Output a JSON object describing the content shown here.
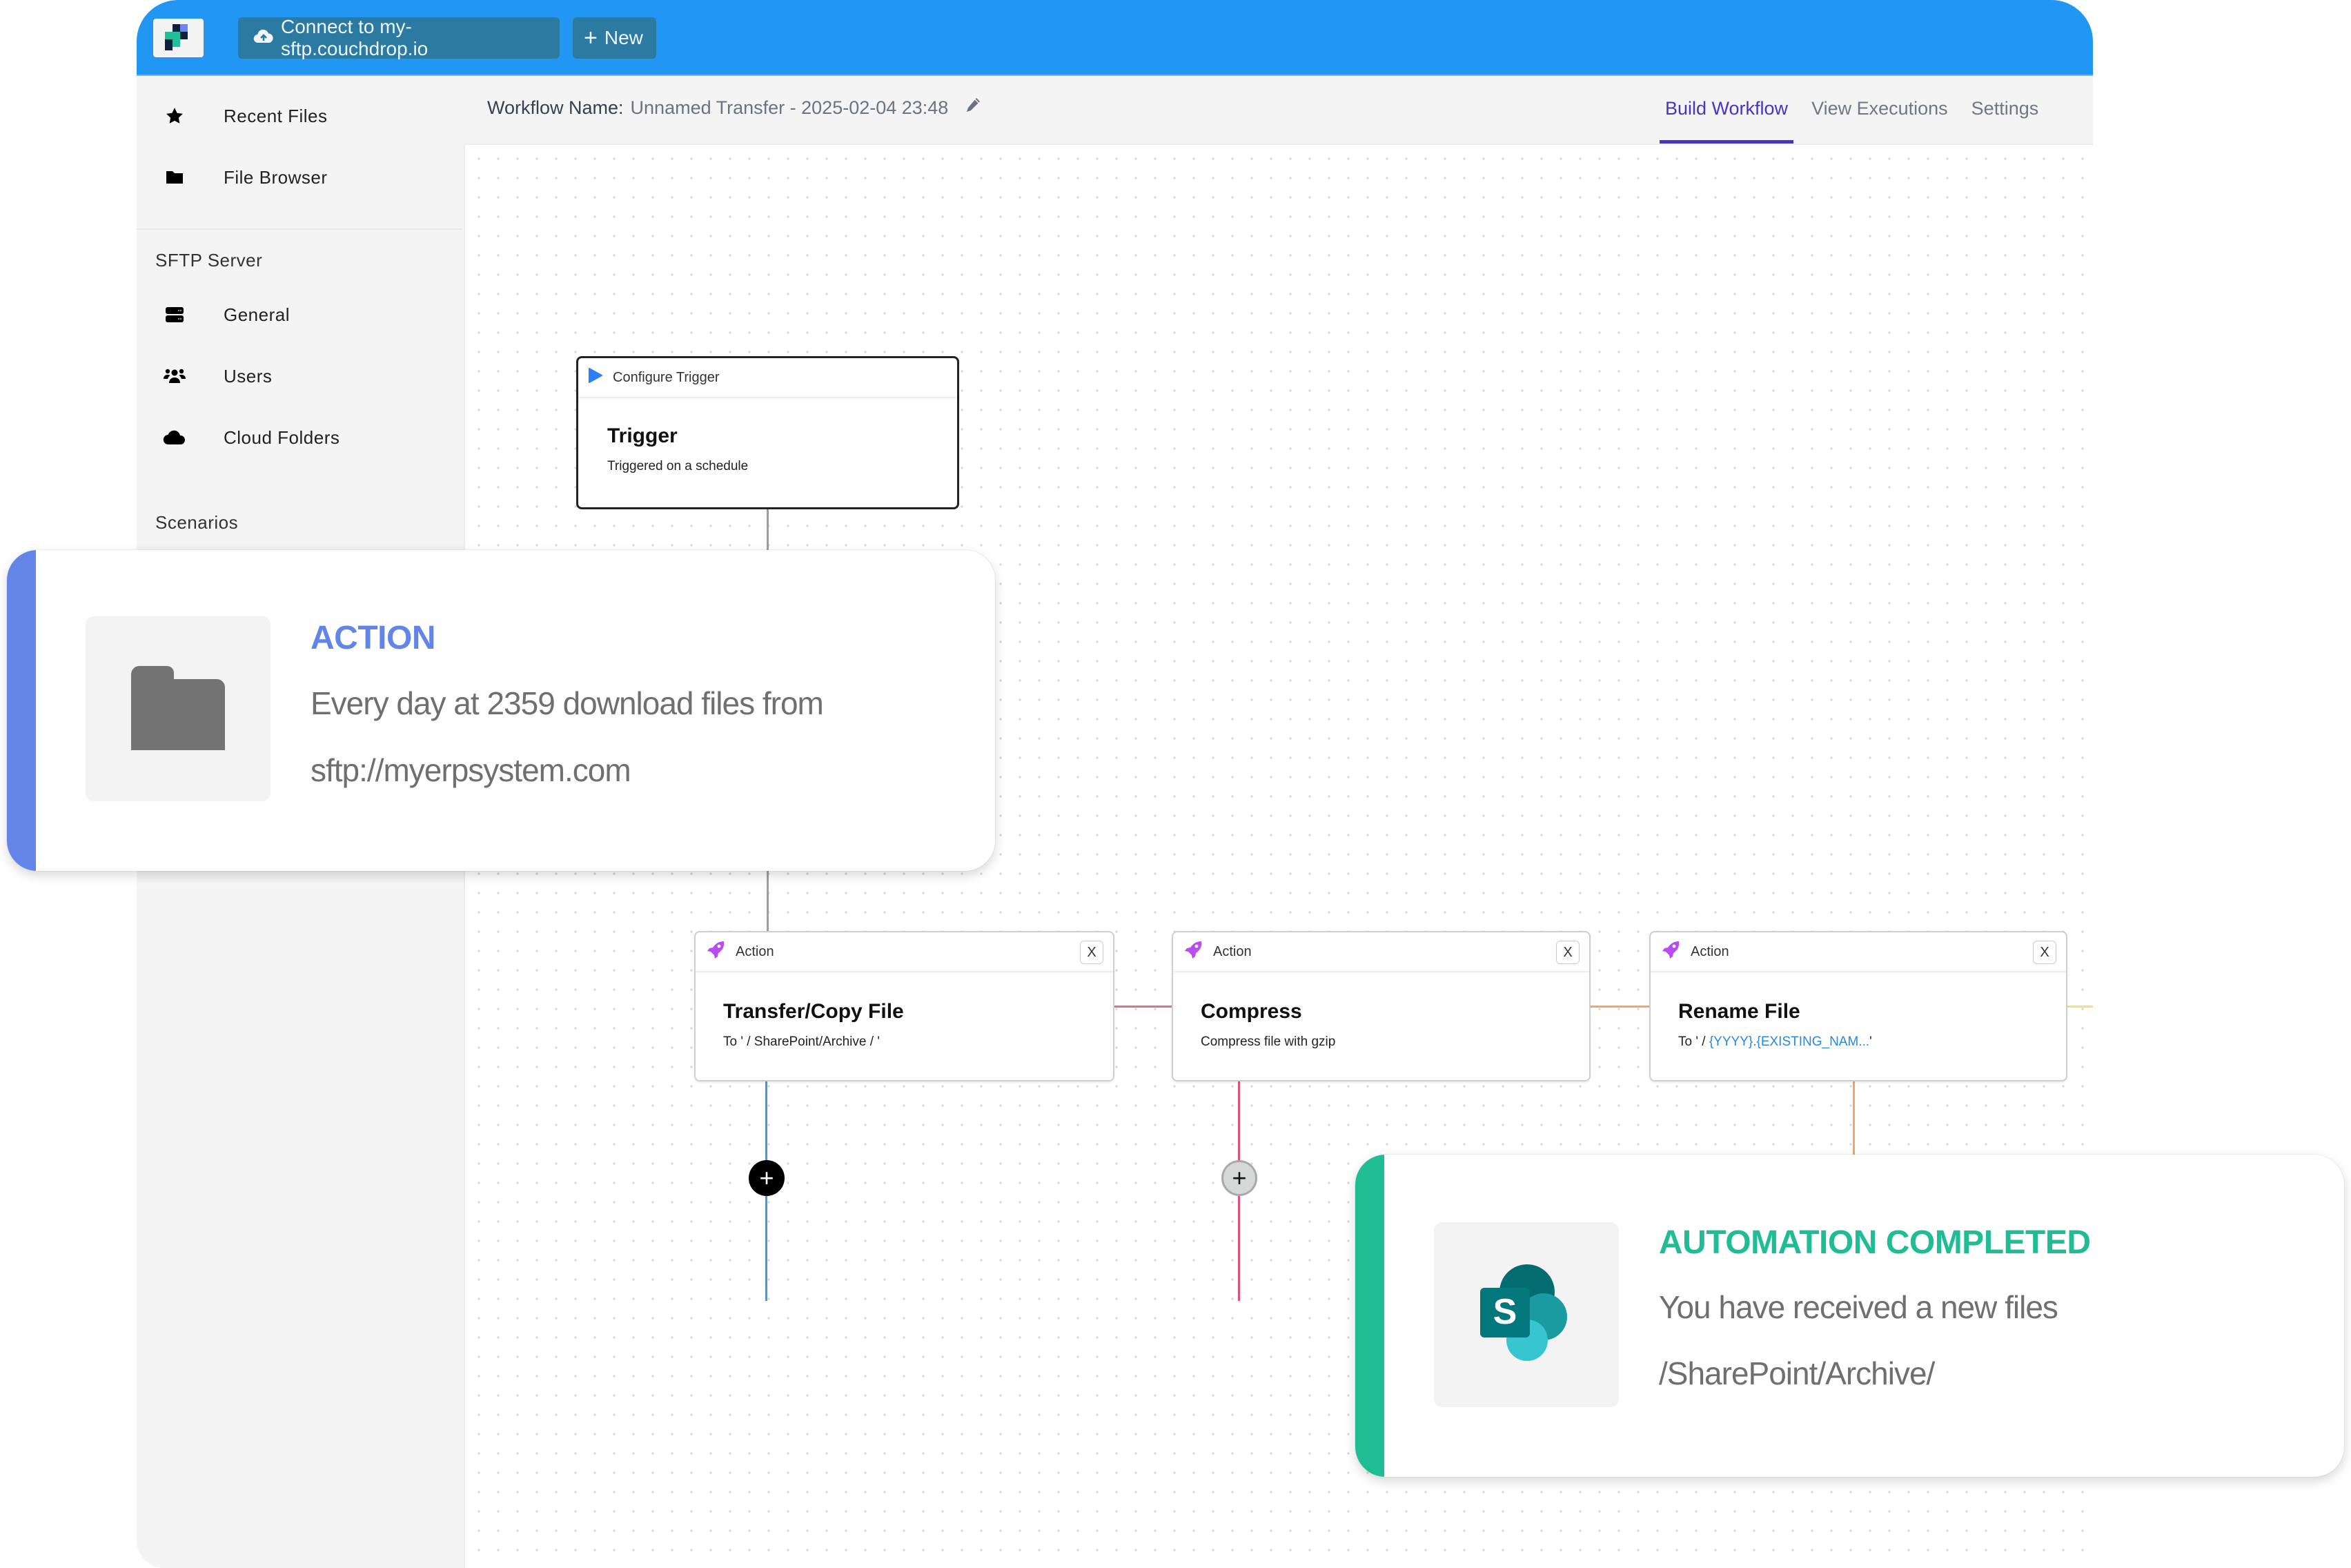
{
  "topbar": {
    "brand_colors": {
      "bar": "#2196F3",
      "button": "#2a7aa1"
    },
    "connect_button": "Connect to my-sftp.couchdrop.io",
    "new_button": "New"
  },
  "sidebar": {
    "primary_items": [
      {
        "label": "Recent Files",
        "icon": "star-icon"
      },
      {
        "label": "File Browser",
        "icon": "folder-icon"
      }
    ],
    "sftp_section": {
      "heading": "SFTP Server",
      "items": [
        {
          "label": "General",
          "icon": "server-icon"
        },
        {
          "label": "Users",
          "icon": "users-icon"
        },
        {
          "label": "Cloud Folders",
          "icon": "cloud-icon"
        }
      ]
    },
    "scenarios_heading": "Scenarios"
  },
  "subheader": {
    "workflow_label": "Workflow Name:",
    "workflow_name": "Unnamed Transfer - 2025-02-04 23:48",
    "tabs": [
      {
        "label": "Build Workflow",
        "active": true
      },
      {
        "label": "View Executions",
        "active": false
      },
      {
        "label": "Settings",
        "active": false
      }
    ],
    "accent_color": "#4b32c3"
  },
  "workflow": {
    "trigger": {
      "header": "Configure Trigger",
      "title": "Trigger",
      "subtitle": "Triggered on a schedule"
    },
    "actions": [
      {
        "header": "Action",
        "title": "Transfer/Copy File",
        "subtitle_prefix": "To ' / SharePoint/Archive / '",
        "subtitle_var": "",
        "subtitle_suffix": "",
        "close": "X"
      },
      {
        "header": "Action",
        "title": "Compress",
        "subtitle_prefix": "Compress file with gzip",
        "subtitle_var": "",
        "subtitle_suffix": "",
        "close": "X"
      },
      {
        "header": "Action",
        "title": "Rename File",
        "subtitle_prefix": "To ' / ",
        "subtitle_var": "{YYYY}.{EXISTING_NAM...",
        "subtitle_suffix": "'",
        "close": "X"
      }
    ],
    "add_step_label": "+",
    "connector_colors": {
      "trigger": "#9e9e9e",
      "transfer_down": "#3a9be0",
      "transfer_to_compress": "#e0708a",
      "compress_down": "#e0507a",
      "compress_to_rename": "#f3a36b",
      "rename_down": "#f3a36b",
      "rename_to_add": "#f2e27a"
    }
  },
  "overlays": {
    "action_card": {
      "title": "ACTION",
      "line1": "Every day at 2359 download files from",
      "line2": "sftp://myerpsystem.com",
      "accent": "#6385e8",
      "icon": "folder-icon"
    },
    "completed_card": {
      "title": "AUTOMATION COMPLETED",
      "line1": "You have received a new files",
      "line2": "/SharePoint/Archive/",
      "accent": "#20bd94",
      "icon": "sharepoint-icon"
    }
  }
}
